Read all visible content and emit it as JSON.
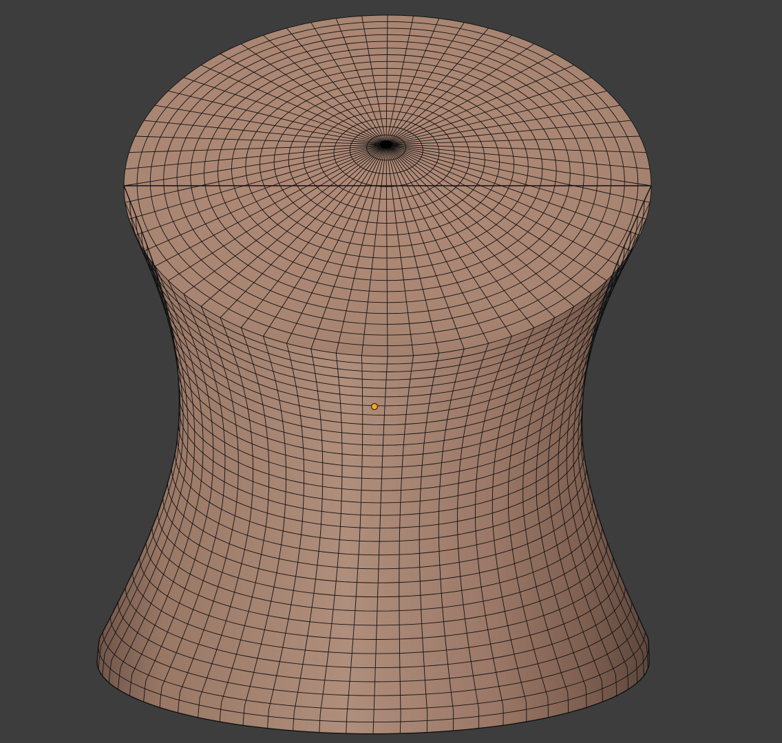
{
  "viewport": {
    "background_color": "#3d3d3d",
    "mode": "edit-mode-wireframe-over-solid",
    "mesh": {
      "name": "",
      "shape": "bulging-cylinder-cork",
      "face_color": "#a98572",
      "wire_color": "#111111",
      "pole_vertex_color": "#000000",
      "radial_segments": 64,
      "top_rings": 18,
      "side_rows": 32
    },
    "origin_marker": {
      "color": "#f5a623",
      "outline_color": "#3a2400",
      "shape": "small-circle"
    }
  }
}
